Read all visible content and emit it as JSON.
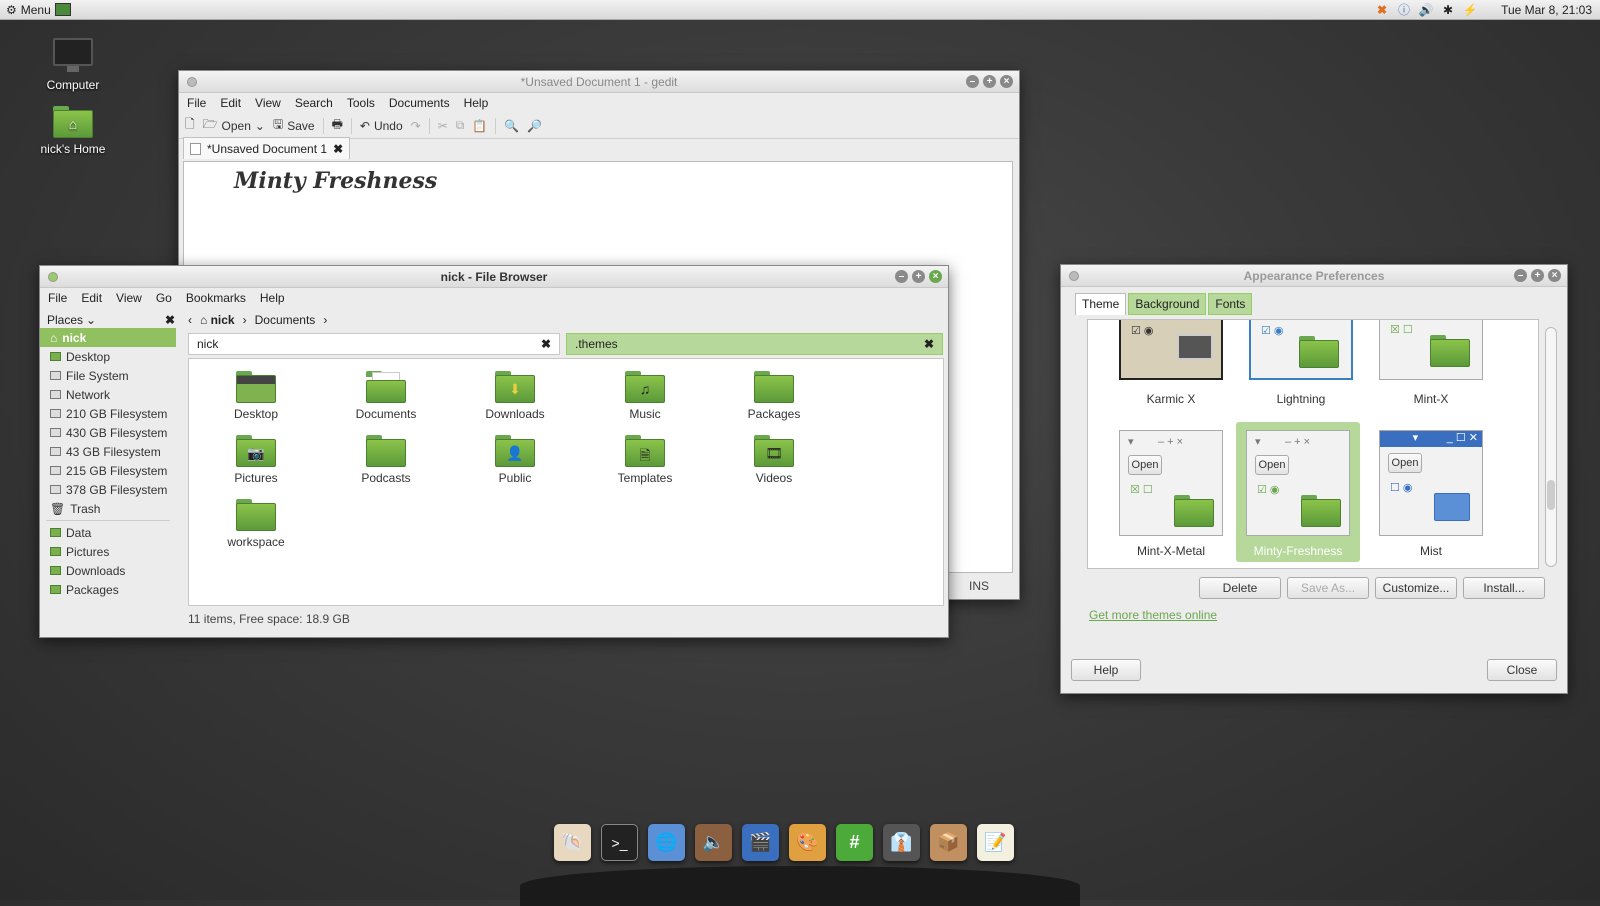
{
  "topbar": {
    "menu_label": "Menu",
    "clock": "Tue Mar  8, 21:03"
  },
  "desktop": {
    "computer": "Computer",
    "home": "nick's Home"
  },
  "gedit": {
    "title": "*Unsaved Document 1 - gedit",
    "menus": [
      "File",
      "Edit",
      "View",
      "Search",
      "Tools",
      "Documents",
      "Help"
    ],
    "toolbar": {
      "open": "Open",
      "save": "Save",
      "undo": "Undo"
    },
    "tab": "*Unsaved Document 1",
    "content": "Minty Freshness",
    "status_ins": "INS"
  },
  "filebrowser": {
    "title": "nick - File Browser",
    "menus": [
      "File",
      "Edit",
      "View",
      "Go",
      "Bookmarks",
      "Help"
    ],
    "places_label": "Places",
    "breadcrumb": {
      "home": "nick",
      "current": "Documents"
    },
    "tabs": {
      "left": "nick",
      "right": ".themes"
    },
    "places": [
      "nick",
      "Desktop",
      "File System",
      "Network",
      "210 GB Filesystem",
      "430 GB Filesystem",
      "43 GB Filesystem",
      "215 GB Filesystem",
      "378 GB Filesystem",
      "Trash",
      "Data",
      "Pictures",
      "Downloads",
      "Packages"
    ],
    "items": [
      "Desktop",
      "Documents",
      "Downloads",
      "Music",
      "Packages",
      "Pictures",
      "Podcasts",
      "Public",
      "Templates",
      "Videos",
      "workspace"
    ],
    "status": "11 items, Free space: 18.9 GB"
  },
  "appearance": {
    "title": "Appearance Preferences",
    "tabs": [
      "Theme",
      "Background",
      "Fonts"
    ],
    "themes": [
      "Karmic X",
      "Lightning",
      "Mint-X",
      "Mint-X-Metal",
      "Minty-Freshness",
      "Mist"
    ],
    "open_label": "Open",
    "buttons": {
      "delete": "Delete",
      "save_as": "Save As...",
      "customize": "Customize...",
      "install": "Install...",
      "help": "Help",
      "close": "Close"
    },
    "link": "Get more themes online"
  },
  "colors": {
    "accent": "#90c060",
    "folder": "#7aaf4e"
  }
}
